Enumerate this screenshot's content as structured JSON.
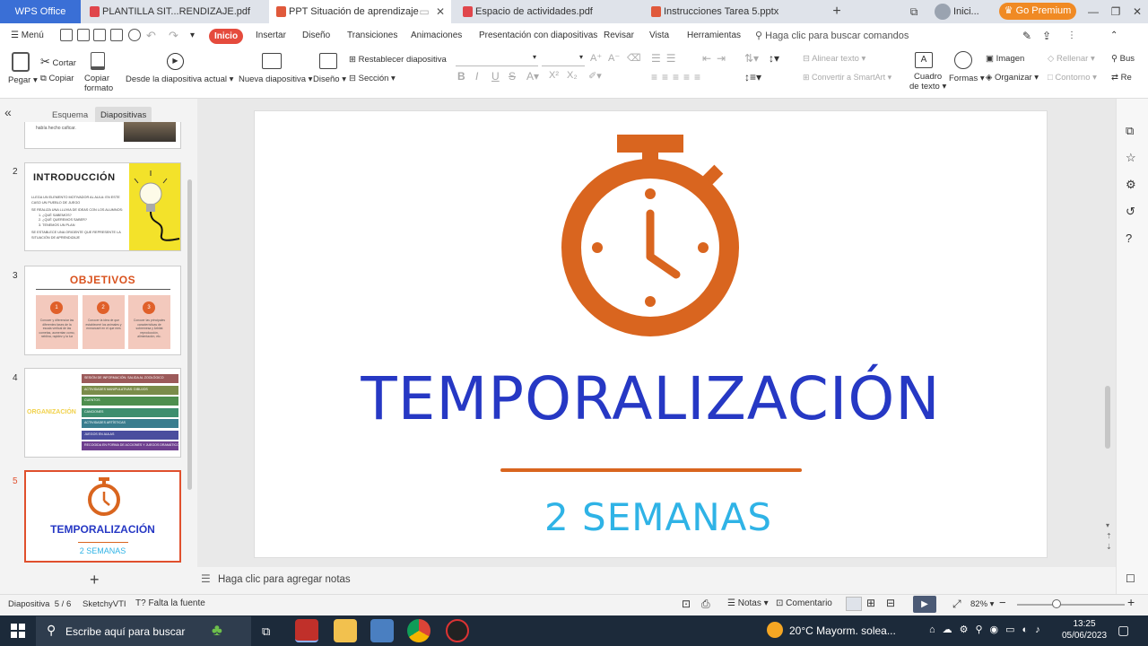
{
  "tabs": {
    "app": "WPS Office",
    "docs": [
      {
        "label": "PLANTILLA SIT...RENDIZAJE.pdf",
        "color": "#e0464b"
      },
      {
        "label": "PPT Situación de aprendizaje",
        "color": "#e0593b"
      },
      {
        "label": "Espacio de actividades.pdf",
        "color": "#e0464b"
      },
      {
        "label": "Instrucciones Tarea 5.pptx",
        "color": "#e0593b"
      }
    ],
    "add": "+",
    "login": "Inici...",
    "premium": "Go Premium"
  },
  "menu": {
    "menu_label": "Menú",
    "items": [
      "Inicio",
      "Insertar",
      "Diseño",
      "Transiciones",
      "Animaciones",
      "Presentación con diapositivas",
      "Revisar",
      "Vista",
      "Herramientas"
    ],
    "search_placeholder": "Haga clic para buscar comandos"
  },
  "ribbon": {
    "pegar": "Pegar",
    "cortar": "Cortar",
    "copiar": "Copiar",
    "copiar_formato_1": "Copiar",
    "copiar_formato_2": "formato",
    "desde_diapositiva": "Desde la diapositiva actual",
    "nueva_diapositiva": "Nueva diapositiva",
    "diseno": "Diseño",
    "restablecer": "Restablecer diapositiva",
    "seccion": "Sección",
    "alinear_texto": "Alinear texto",
    "convertir_smartart": "Convertir a SmartArt",
    "cuadro_texto_1": "Cuadro",
    "cuadro_texto_2": "de texto",
    "formas": "Formas",
    "imagen": "Imagen",
    "organizar": "Organizar",
    "rellenar": "Rellenar",
    "contorno": "Contorno",
    "buscar": "Bus",
    "reemplazar": "Re"
  },
  "panel": {
    "tab_esquema": "Esquema",
    "tab_diapositivas": "Diapositivas",
    "slide1_text": "había hecho caficar.",
    "slide2": {
      "num": "2",
      "title": "INTRODUCCIÓN",
      "bullets": [
        "LLEGA UN ELEMENTO MOTIVADOR AL AULA: EN ESTE CASO UN PUEBLO DE JUEGO",
        "SE REALIZA UNA LLUVIA DE IDEAS CON LOS ALUMNOS:",
        "1. ¿QUÉ SABEMOS?",
        "2. ¿QUÉ QUEREMOS SABER?",
        "3. TENEMOS UN PLAN",
        "SE ESTABLECE UNA ORIGENTE QUE REPRESENTE LA SITUACIÓN DE APRENDIZAJE"
      ]
    },
    "slide3": {
      "num": "3",
      "title": "OBJETIVOS",
      "cards": [
        {
          "n": "1",
          "text": "Conocer y diferenciar las diferentes fases de la escala vertical de las cometas, aumentan como, neblina, rapidez y la luz"
        },
        {
          "n": "2",
          "text": "Conocer la idea de que estableceré los animales y enmarcaré en el que mes"
        },
        {
          "n": "3",
          "text": "Conocer las principales características de sobremesa y lizbitat reproducción, alimentación, etc."
        }
      ]
    },
    "slide4": {
      "num": "4",
      "side_label": "ORGANIZACIÓN",
      "rows": [
        {
          "text": "SESIÓN DE INFORMACIÓN: SALIDA AL ZOOLÓGICO",
          "color": "#9c5a5a"
        },
        {
          "text": "ACTIVIDADES MANIPULATIVAS: DIBUJOS",
          "color": "#7a8c4a"
        },
        {
          "text": "CUENTOS",
          "color": "#4e8e4e"
        },
        {
          "text": "CANCIONES",
          "color": "#3e8e6e"
        },
        {
          "text": "ACTIVIDADES ARTÍSTICAS",
          "color": "#3a7d8e"
        },
        {
          "text": "JUEGOS EN AULAS",
          "color": "#4a4e9e"
        },
        {
          "text": "RECOGIDA EN FORMA DE ACCIONES Y JUEGOS DRAMÁTICOS",
          "color": "#6e3e8e"
        }
      ]
    },
    "slide5": {
      "num": "5",
      "title": "TEMPORALIZACIÓN",
      "subtitle": "2 SEMANAS"
    },
    "add_slide": "+"
  },
  "slide": {
    "title": "TEMPORALIZACIÓN",
    "subtitle": "2 SEMANAS",
    "colors": {
      "icon": "#d9651f",
      "title": "#2638c4",
      "subtitle": "#2fb3e6",
      "line": "#d9651f"
    }
  },
  "notes": {
    "placeholder": "Haga clic para agregar notas"
  },
  "status": {
    "slide_label": "Diapositiva",
    "slide_pos": "5 / 6",
    "theme": "SketchyVTI",
    "missing_font": "Falta la fuente",
    "notes_btn": "Notas",
    "comment_btn": "Comentario",
    "zoom": "82%"
  },
  "taskbar": {
    "search": "Escribe aquí para buscar",
    "weather": "20°C  Mayorm. solea...",
    "time": "13:25",
    "date": "05/06/2023"
  }
}
